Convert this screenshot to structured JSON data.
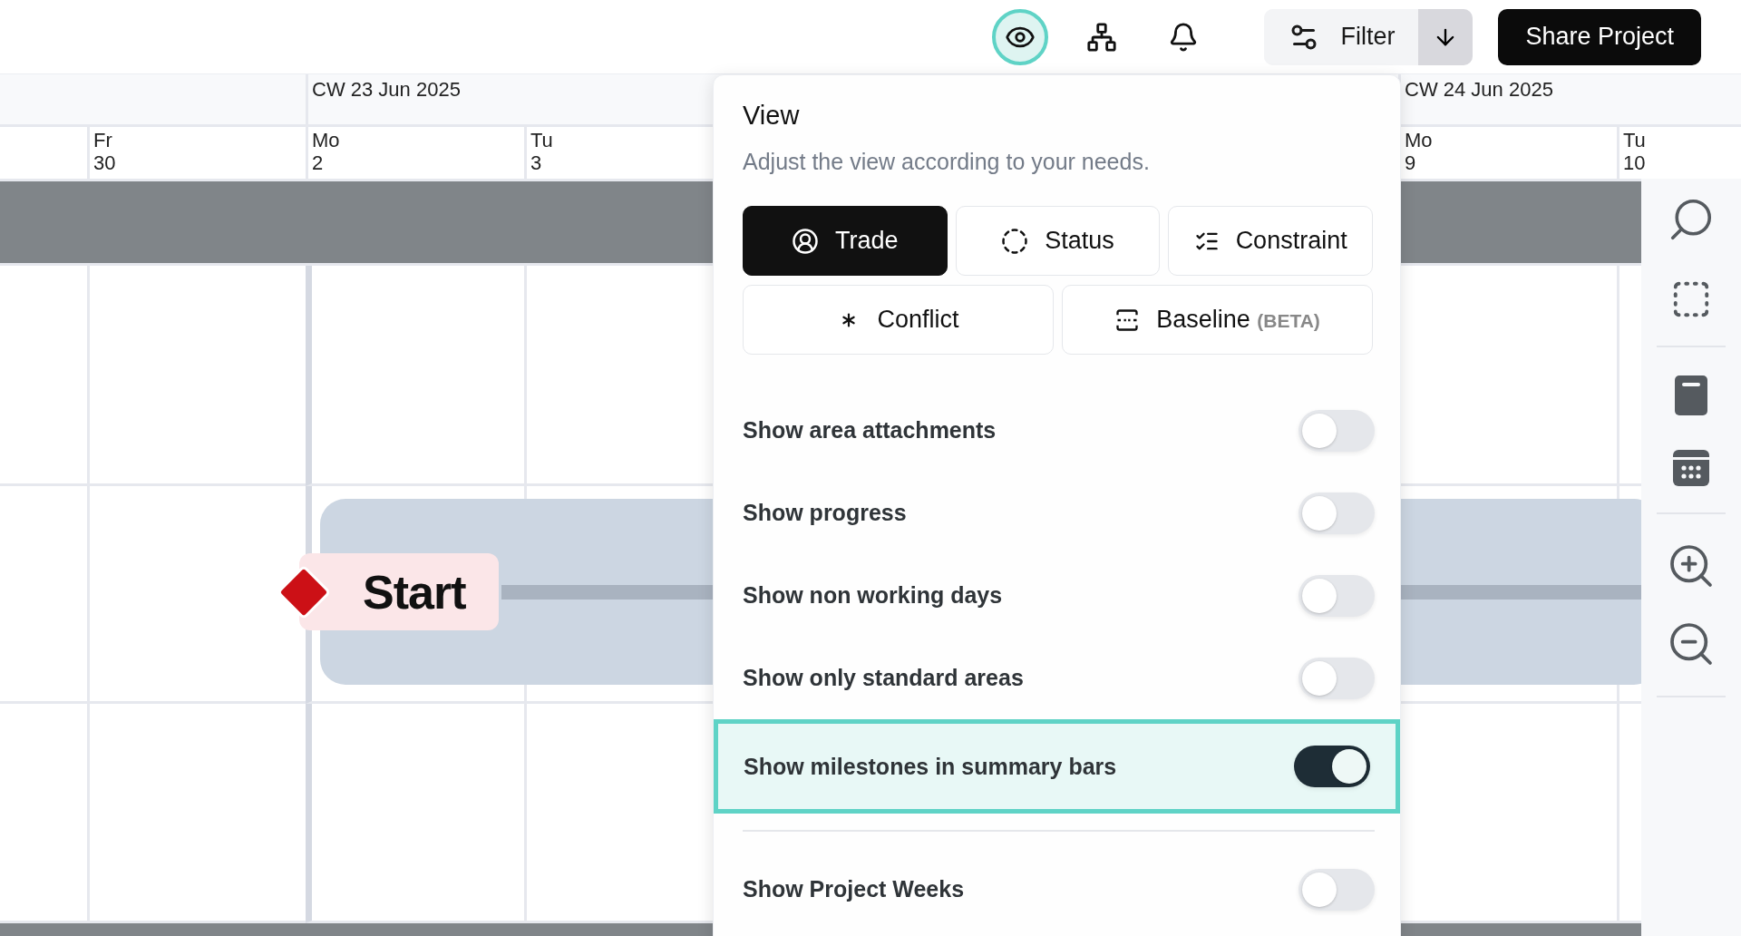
{
  "toolbar": {
    "icon_buttons": [
      {
        "kind": "view",
        "selected": true
      },
      {
        "kind": "hierarchy",
        "selected": false
      },
      {
        "kind": "notifications",
        "selected": false
      }
    ],
    "filter": {
      "label": "Filter"
    },
    "share_button": {
      "label": "Share Project"
    }
  },
  "timeline": {
    "weeks": [
      {
        "label": "CW 23 Jun 2025"
      },
      {
        "label": "CW 24 Jun 2025"
      }
    ],
    "days": [
      {
        "weekday": "Fr",
        "date": "30"
      },
      {
        "weekday": "Mo",
        "date": "2"
      },
      {
        "weekday": "Tu",
        "date": "3"
      },
      {
        "weekday": "Mo",
        "date": "9"
      },
      {
        "weekday": "Tu",
        "date": "10"
      }
    ],
    "milestone": {
      "label": "Start"
    }
  },
  "view_panel": {
    "title": "View",
    "subtitle": "Adjust the view according to your needs.",
    "modes": [
      {
        "kind": "trade",
        "label": "Trade",
        "selected": true
      },
      {
        "kind": "status",
        "label": "Status",
        "selected": false
      },
      {
        "kind": "constraint",
        "label": "Constraint",
        "selected": false
      },
      {
        "kind": "conflict",
        "label": "Conflict",
        "selected": false
      },
      {
        "kind": "baseline",
        "label": "Baseline",
        "tag": "(BETA)",
        "selected": false
      }
    ],
    "options": [
      {
        "label": "Show area attachments",
        "on": false,
        "highlighted": false
      },
      {
        "label": "Show progress",
        "on": false,
        "highlighted": false
      },
      {
        "label": "Show non working days",
        "on": false,
        "highlighted": false
      },
      {
        "label": "Show only standard areas",
        "on": false,
        "highlighted": false
      },
      {
        "label": "Show milestones in summary bars",
        "on": true,
        "highlighted": true
      },
      {
        "label": "Show Project Weeks",
        "on": false,
        "highlighted": false,
        "separated": true
      }
    ]
  }
}
